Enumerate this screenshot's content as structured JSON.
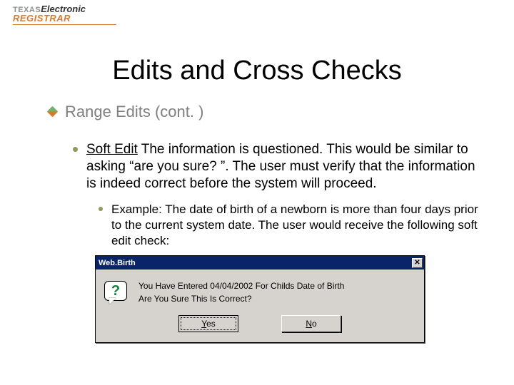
{
  "logo": {
    "line1_left": "TEXAS",
    "line1_right": "Electronic",
    "line2": "REGISTRAR"
  },
  "title": "Edits and Cross Checks",
  "lvl1": "Range Edits (cont. )",
  "lvl2": {
    "term": "Soft Edit",
    "body": "  The information is questioned.  This would be similar to asking “are you sure? ”.  The user must verify that the information is indeed correct before the system will proceed."
  },
  "lvl3": "Example:  The date of birth of a newborn is more than four days prior to the current system date.  The user would receive the following soft edit check:",
  "dialog": {
    "title": "Web.Birth",
    "close_glyph": "✕",
    "icon_glyph": "?",
    "msg_line1": "You Have Entered 04/04/2002 For Childs Date of Birth",
    "msg_line2": "Are You Sure This Is Correct?",
    "yes_u": "Y",
    "yes_rest": "es",
    "no_u": "N",
    "no_rest": "o"
  }
}
